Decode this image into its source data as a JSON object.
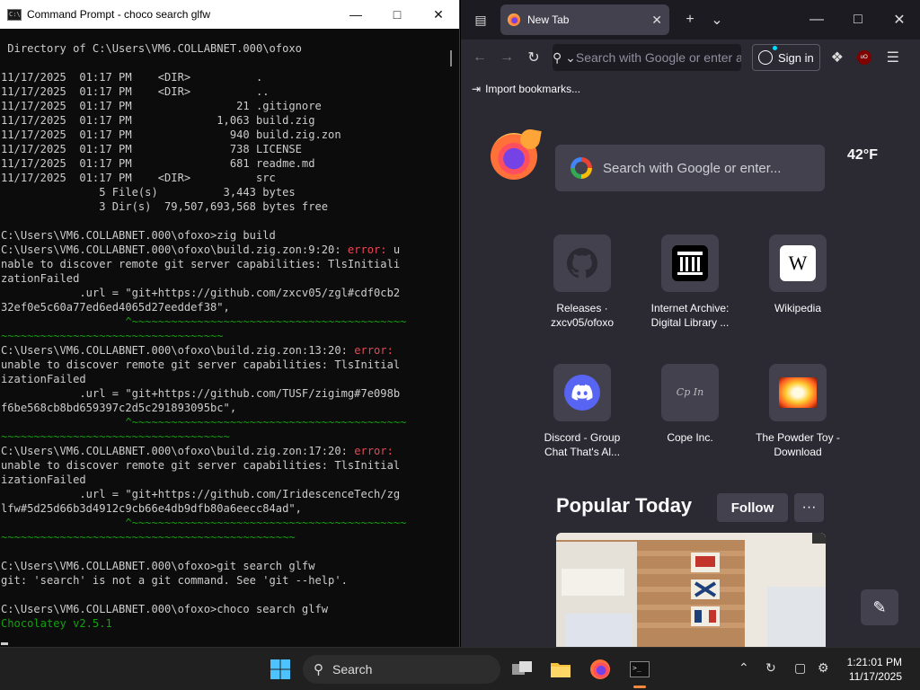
{
  "cmd": {
    "title": "Command Prompt - choco  search glfw",
    "lines": [
      [
        {
          "t": " Directory of C:\\Users\\VM6.COLLABNET.000\\ofoxo"
        }
      ],
      [
        {
          "t": ""
        }
      ],
      [
        {
          "t": "11/17/2025  01:17 PM    <DIR>          ."
        }
      ],
      [
        {
          "t": "11/17/2025  01:17 PM    <DIR>          .."
        }
      ],
      [
        {
          "t": "11/17/2025  01:17 PM                21 .gitignore"
        }
      ],
      [
        {
          "t": "11/17/2025  01:17 PM             1,063 build.zig"
        }
      ],
      [
        {
          "t": "11/17/2025  01:17 PM               940 build.zig.zon"
        }
      ],
      [
        {
          "t": "11/17/2025  01:17 PM               738 LICENSE"
        }
      ],
      [
        {
          "t": "11/17/2025  01:17 PM               681 readme.md"
        }
      ],
      [
        {
          "t": "11/17/2025  01:17 PM    <DIR>          src"
        }
      ],
      [
        {
          "t": "               5 File(s)          3,443 bytes"
        }
      ],
      [
        {
          "t": "               3 Dir(s)  79,507,693,568 bytes free"
        }
      ],
      [
        {
          "t": ""
        }
      ],
      [
        {
          "t": "C:\\Users\\VM6.COLLABNET.000\\ofoxo>zig build"
        }
      ],
      [
        {
          "t": "C:\\Users\\VM6.COLLABNET.000\\ofoxo\\build.zig.zon:9:20: "
        },
        {
          "t": "error:",
          "c": "err"
        },
        {
          "t": " u"
        }
      ],
      [
        {
          "t": "nable to discover remote git server capabilities: TlsInitiali"
        }
      ],
      [
        {
          "t": "zationFailed"
        }
      ],
      [
        {
          "t": "            .url = \"git+https://github.com/zxcv05/zgl#cdf0cb2"
        }
      ],
      [
        {
          "t": "32ef0e5c60a77ed6ed4065d27eeddef38\","
        }
      ],
      [
        {
          "t": "                   ^~~~~~~~~~~~~~~~~~~~~~~~~~~~~~~~~~~~~~~~~~~",
          "c": "grn"
        }
      ],
      [
        {
          "t": "~~~~~~~~~~~~~~~~~~~~~~~~~~~~~~~~~~",
          "c": "grn"
        }
      ],
      [
        {
          "t": "C:\\Users\\VM6.COLLABNET.000\\ofoxo\\build.zig.zon:13:20: "
        },
        {
          "t": "error:",
          "c": "err"
        }
      ],
      [
        {
          "t": "unable to discover remote git server capabilities: TlsInitial"
        }
      ],
      [
        {
          "t": "izationFailed"
        }
      ],
      [
        {
          "t": "            .url = \"git+https://github.com/TUSF/zigimg#7e098b"
        }
      ],
      [
        {
          "t": "f6be568cb8bd659397c2d5c291893095bc\","
        }
      ],
      [
        {
          "t": "                   ^~~~~~~~~~~~~~~~~~~~~~~~~~~~~~~~~~~~~~~~~~~",
          "c": "grn"
        }
      ],
      [
        {
          "t": "~~~~~~~~~~~~~~~~~~~~~~~~~~~~~~~~~~~",
          "c": "grn"
        }
      ],
      [
        {
          "t": "C:\\Users\\VM6.COLLABNET.000\\ofoxo\\build.zig.zon:17:20: "
        },
        {
          "t": "error:",
          "c": "err"
        }
      ],
      [
        {
          "t": "unable to discover remote git server capabilities: TlsInitial"
        }
      ],
      [
        {
          "t": "izationFailed"
        }
      ],
      [
        {
          "t": "            .url = \"git+https://github.com/IridescenceTech/zg"
        }
      ],
      [
        {
          "t": "lfw#5d25d66b3d4912c9cb66e4db9dfb80a6eecc84ad\","
        }
      ],
      [
        {
          "t": "                   ^~~~~~~~~~~~~~~~~~~~~~~~~~~~~~~~~~~~~~~~~~~",
          "c": "grn"
        }
      ],
      [
        {
          "t": "~~~~~~~~~~~~~~~~~~~~~~~~~~~~~~~~~~~~~~~~~~~~~",
          "c": "grn"
        }
      ],
      [
        {
          "t": ""
        }
      ],
      [
        {
          "t": "C:\\Users\\VM6.COLLABNET.000\\ofoxo>git search glfw"
        }
      ],
      [
        {
          "t": "git: 'search' is not a git command. See 'git --help'."
        }
      ],
      [
        {
          "t": ""
        }
      ],
      [
        {
          "t": "C:\\Users\\VM6.COLLABNET.000\\ofoxo>choco search glfw"
        }
      ],
      [
        {
          "t": "Chocolatey v2.5.1",
          "c": "grn"
        }
      ]
    ]
  },
  "firefox": {
    "tab_title": "New Tab",
    "url_placeholder": "Search with Google or enter address",
    "signin_label": "Sign in",
    "bookmarks_label": "Import bookmarks...",
    "newtab_search_placeholder": "Search with Google or enter...",
    "weather": "42°F",
    "shortcuts": [
      {
        "label1": "Releases ·",
        "label2": "zxcv05/ofoxo",
        "icon": "github-icon"
      },
      {
        "label1": "Internet Archive:",
        "label2": "Digital Library ...",
        "icon": "internet-archive-icon"
      },
      {
        "label1": "Wikipedia",
        "label2": "",
        "icon": "wikipedia-icon"
      },
      {
        "label1": "Discord - Group",
        "label2": "Chat That's Al...",
        "icon": "discord-icon"
      },
      {
        "label1": "Cope Inc.",
        "label2": "",
        "icon": "cope-inc-icon"
      },
      {
        "label1": "The Powder Toy -",
        "label2": "Download",
        "icon": "powder-toy-icon"
      }
    ],
    "popular_title": "Popular Today",
    "follow_label": "Follow",
    "more_label": "···"
  },
  "taskbar": {
    "search_label": "Search",
    "time": "1:21:01 PM",
    "date": "11/17/2025"
  }
}
